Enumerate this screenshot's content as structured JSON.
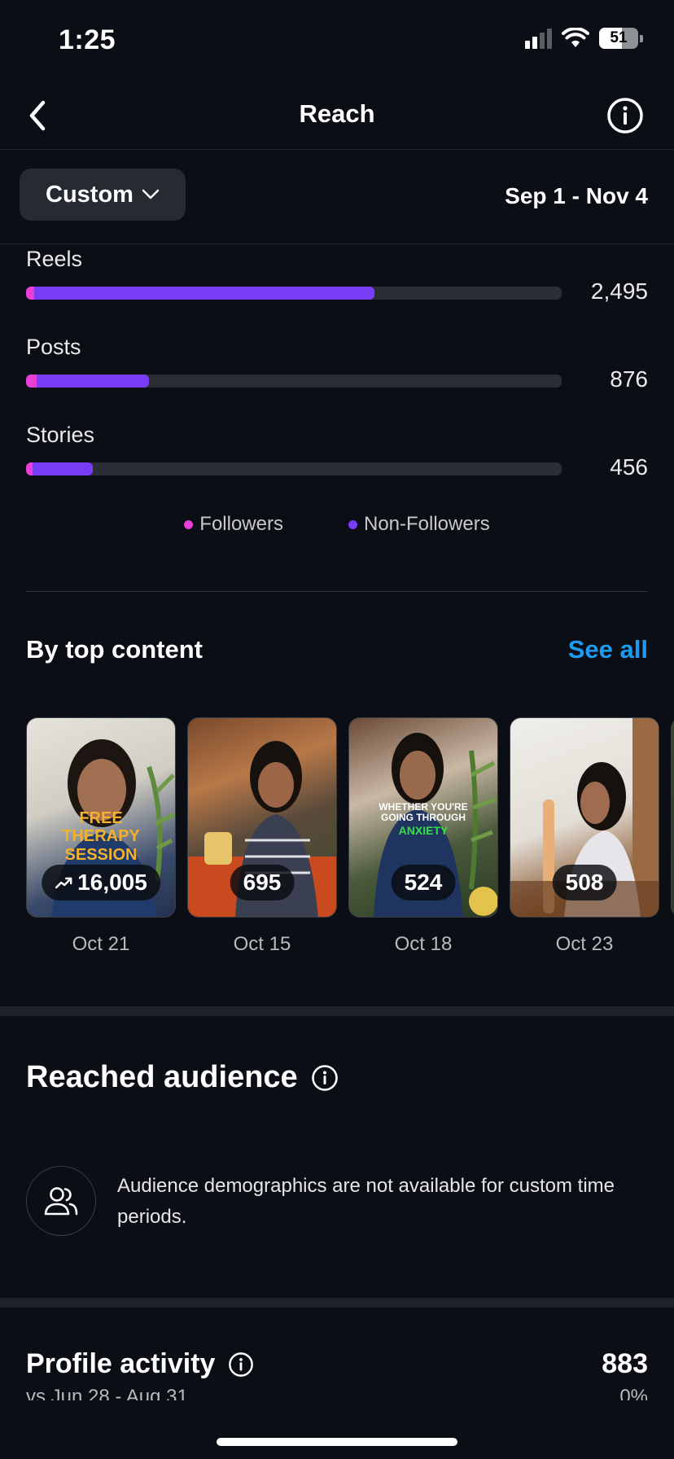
{
  "status_bar": {
    "time": "1:25",
    "battery": "51"
  },
  "header": {
    "title": "Reach",
    "back_icon": "chevron-left-icon",
    "info_icon": "info-icon"
  },
  "filter": {
    "range_type": "Custom",
    "date_range": "Sep 1 - Nov 4"
  },
  "breakdown": {
    "rows": [
      {
        "label": "Reels",
        "value": "2,495",
        "fill_fraction": 0.65,
        "follower_fraction": 0.015
      },
      {
        "label": "Posts",
        "value": "876",
        "fill_fraction": 0.23,
        "follower_fraction": 0.02
      },
      {
        "label": "Stories",
        "value": "456",
        "fill_fraction": 0.125,
        "follower_fraction": 0.012
      }
    ],
    "legend": {
      "followers": "Followers",
      "non_followers": "Non-Followers"
    },
    "colors": {
      "followers": "#e93fd8",
      "non_followers": "#7b3cf7"
    }
  },
  "top_content": {
    "title": "By top content",
    "see_all": "See all",
    "items": [
      {
        "count": "16,005",
        "date": "Oct 21",
        "trend_icon": "trending-up-icon",
        "caption": "FREE\nTHERAPY\nSESSION"
      },
      {
        "count": "695",
        "date": "Oct 15"
      },
      {
        "count": "524",
        "date": "Oct 18",
        "caption_top": "WHETHER YOU'RE\nGOING THROUGH",
        "caption_highlight": "ANXIETY"
      },
      {
        "count": "508",
        "date": "Oct 23"
      }
    ]
  },
  "reached_audience": {
    "title": "Reached audience",
    "message": "Audience demographics are not available for custom time periods."
  },
  "profile_activity": {
    "title": "Profile activity",
    "value": "883",
    "compare": "vs Jun 28 - Aug 31",
    "change": "0%"
  },
  "colors": {
    "accent_link": "#1d9bf0",
    "background": "#0b0e14"
  }
}
